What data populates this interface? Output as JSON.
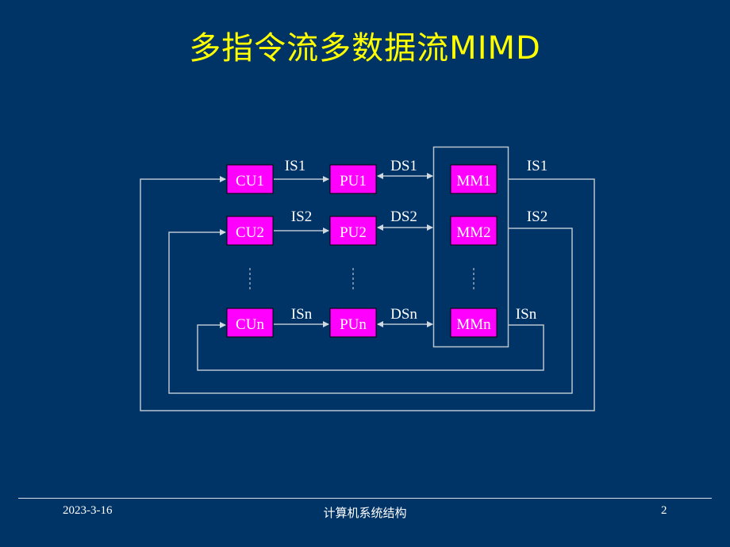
{
  "slide": {
    "title": "多指令流多数据流MIMD"
  },
  "diagram": {
    "rows": [
      {
        "cu": "CU1",
        "pu": "PU1",
        "mm": "MM1",
        "is_label": "IS1",
        "ds_label": "DS1",
        "feedback_label": "IS1"
      },
      {
        "cu": "CU2",
        "pu": "PU2",
        "mm": "MM2",
        "is_label": "IS2",
        "ds_label": "DS2",
        "feedback_label": "IS2"
      },
      {
        "cu": "CUn",
        "pu": "PUn",
        "mm": "MMn",
        "is_label": "ISn",
        "ds_label": "DSn",
        "feedback_label": "ISn"
      }
    ],
    "colors": {
      "background": "#003366",
      "box_fill": "#ff00ff",
      "line": "#b8c4d0",
      "text": "#ffffff",
      "title": "#ffff00"
    }
  },
  "footer": {
    "date": "2023-3-16",
    "course": "计算机系统结构",
    "page": "2"
  }
}
